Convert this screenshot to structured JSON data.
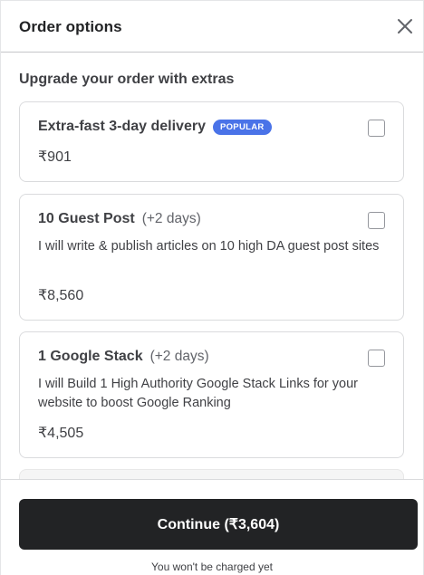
{
  "header": {
    "title": "Order options",
    "close_icon": "close-icon"
  },
  "section": {
    "title": "Upgrade your order with extras"
  },
  "extras": [
    {
      "title": "Extra-fast 3-day delivery",
      "badge": "POPULAR",
      "extra_days": "",
      "description": "",
      "price": "₹901",
      "checked": false
    },
    {
      "title": "10 Guest Post",
      "badge": "",
      "extra_days": "(+2 days)",
      "description": "I will write & publish articles on 10 high DA guest post sites",
      "price": "₹8,560",
      "checked": false
    },
    {
      "title": "1 Google Stack",
      "badge": "",
      "extra_days": "(+2 days)",
      "description": "I will Build 1 High Authority Google Stack Links for your website to boost Google Ranking",
      "price": "₹4,505",
      "checked": false
    }
  ],
  "footer": {
    "continue_label": "Continue (₹3,604)",
    "note": "You won't be charged yet"
  },
  "colors": {
    "primary_button": "#222325",
    "badge": "#4a73e8"
  }
}
